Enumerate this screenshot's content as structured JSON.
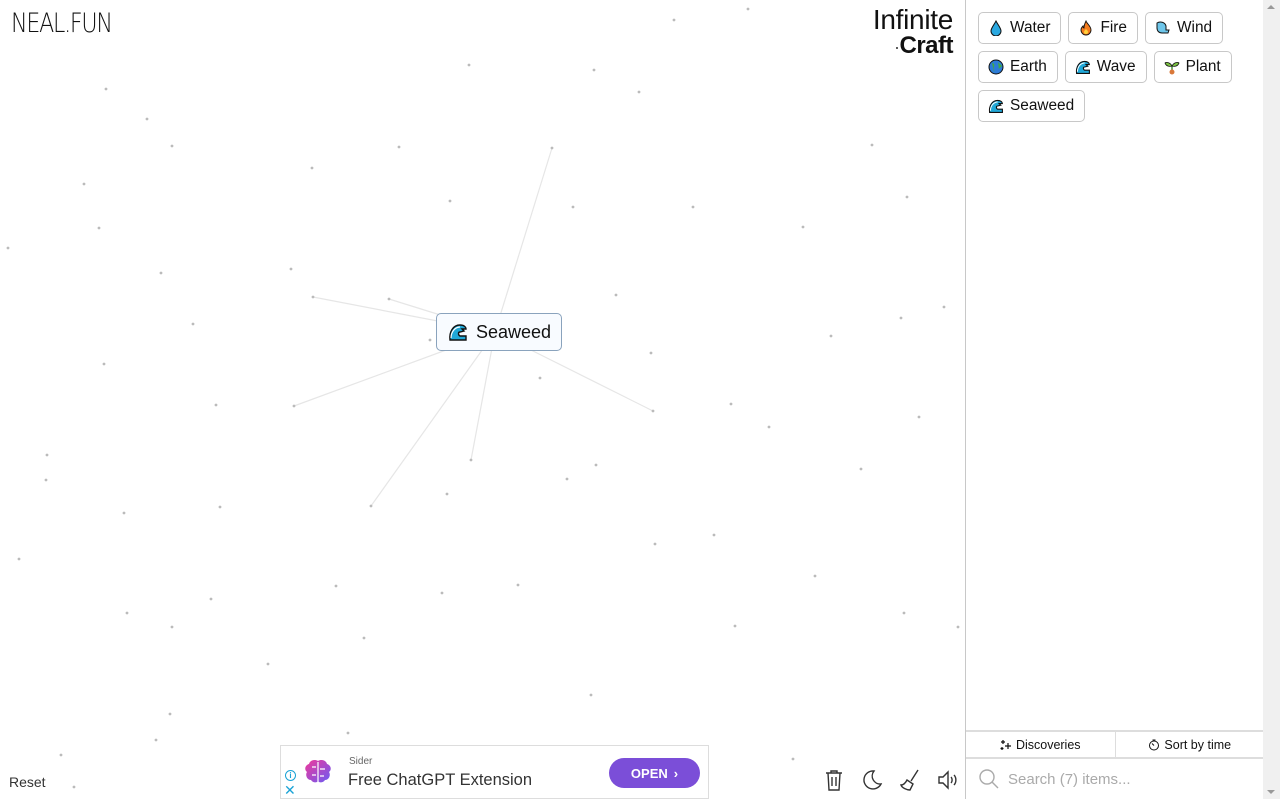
{
  "header": {
    "site_logo": "NEAL.FUN",
    "game_title_line1": "Infinite",
    "game_title_line2": "Craft"
  },
  "canvas": {
    "placed_item": {
      "emoji": "wave-emoji",
      "label": "Seaweed"
    },
    "reset_label": "Reset"
  },
  "sidebar": {
    "items": [
      {
        "emoji": "droplet-emoji",
        "label": "Water"
      },
      {
        "emoji": "fire-emoji",
        "label": "Fire"
      },
      {
        "emoji": "wind-face-emoji",
        "label": "Wind"
      },
      {
        "emoji": "globe-emoji",
        "label": "Earth"
      },
      {
        "emoji": "wave-emoji",
        "label": "Wave"
      },
      {
        "emoji": "seedling-emoji",
        "label": "Plant"
      },
      {
        "emoji": "wave-emoji",
        "label": "Seaweed"
      }
    ],
    "discoveries_label": "Discoveries",
    "sort_label": "Sort by time",
    "search_placeholder": "Search (7) items..."
  },
  "toolbar": {
    "tools": [
      "trash-icon",
      "moon-icon",
      "broom-icon",
      "speaker-icon"
    ]
  },
  "ad": {
    "sponsor": "Sider",
    "headline": "Free ChatGPT Extension",
    "cta_label": "OPEN"
  },
  "colors": {
    "canvas_item_border": "#8aa3bd",
    "item_border": "#c8c8c8",
    "ad_cta": "#7b4ed8"
  }
}
